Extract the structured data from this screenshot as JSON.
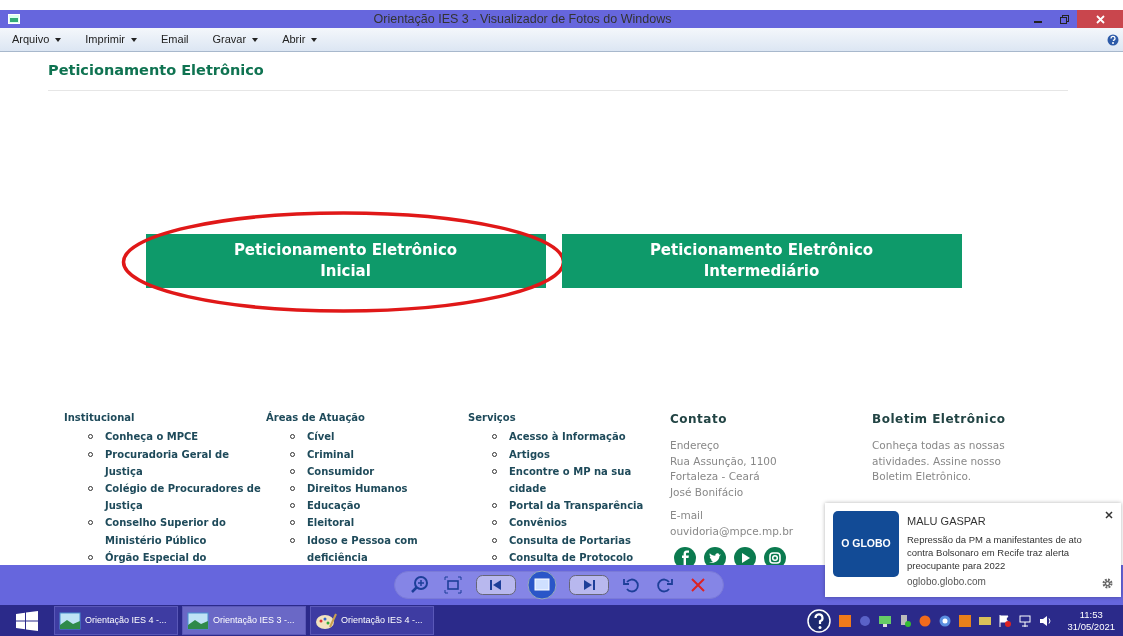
{
  "window": {
    "title": "Orientação IES 3 - Visualizador de Fotos do Windows"
  },
  "menu": [
    {
      "label": "Arquivo",
      "dropdown": true
    },
    {
      "label": "Imprimir",
      "dropdown": true
    },
    {
      "label": "Email",
      "dropdown": false
    },
    {
      "label": "Gravar",
      "dropdown": true
    },
    {
      "label": "Abrir",
      "dropdown": true
    }
  ],
  "page": {
    "heading": "Peticionamento Eletrônico",
    "buttons": [
      {
        "lines": [
          "Peticionamento Eletrônico",
          "Inicial"
        ],
        "circled": true
      },
      {
        "lines": [
          "Peticionamento Eletrônico",
          "Intermediário"
        ],
        "circled": false
      }
    ]
  },
  "footer": {
    "columns": [
      {
        "title": "Institucional",
        "items": [
          "Conheça o MPCE",
          "Procuradoria Geral de Justiça",
          "Colégio de Procuradores de Justiça",
          "Conselho Superior do Ministério Público",
          "Órgão Especial do"
        ]
      },
      {
        "title": "Áreas de Atuação",
        "items": [
          "Cível",
          "Criminal",
          "Consumidor",
          "Direitos Humanos",
          "Educação",
          "Eleitoral",
          "Idoso e Pessoa com deficiência"
        ]
      },
      {
        "title": "Serviços",
        "items": [
          "Acesso à Informação",
          "Artigos",
          "Encontre o MP na sua cidade",
          "Portal da Transparência",
          "Convênios",
          "Consulta de Portarias",
          "Consulta de Protocolo"
        ]
      }
    ],
    "contact": {
      "title": "Contato",
      "blocks": [
        [
          "Endereço",
          "Rua Assunção, 1100",
          "Fortaleza - Ceará",
          "José Bonifácio"
        ],
        [
          "E-mail",
          "ouvidoria@mpce.mp.br"
        ]
      ]
    },
    "newsletter": {
      "title": "Boletim Eletrônico",
      "text": "Conheça todas as nossas atividades. Assine nosso Boletim Eletrônico."
    }
  },
  "notification": {
    "logo": "O GLOBO",
    "author": "MALU GASPAR",
    "text": "Repressão da PM a manifestantes de ato contra Bolsonaro em Recife traz alerta preocupante para 2022",
    "source": "oglobo.globo.com"
  },
  "taskbar": {
    "items": [
      {
        "label": "Orientação IES 4 -...",
        "kind": "photo",
        "selected": false
      },
      {
        "label": "Orientação IES 3 -...",
        "kind": "photo",
        "selected": true
      },
      {
        "label": "Orientação IES 4 -...",
        "kind": "paint",
        "selected": false
      }
    ],
    "time": "11:53",
    "date": "31/05/2021"
  }
}
